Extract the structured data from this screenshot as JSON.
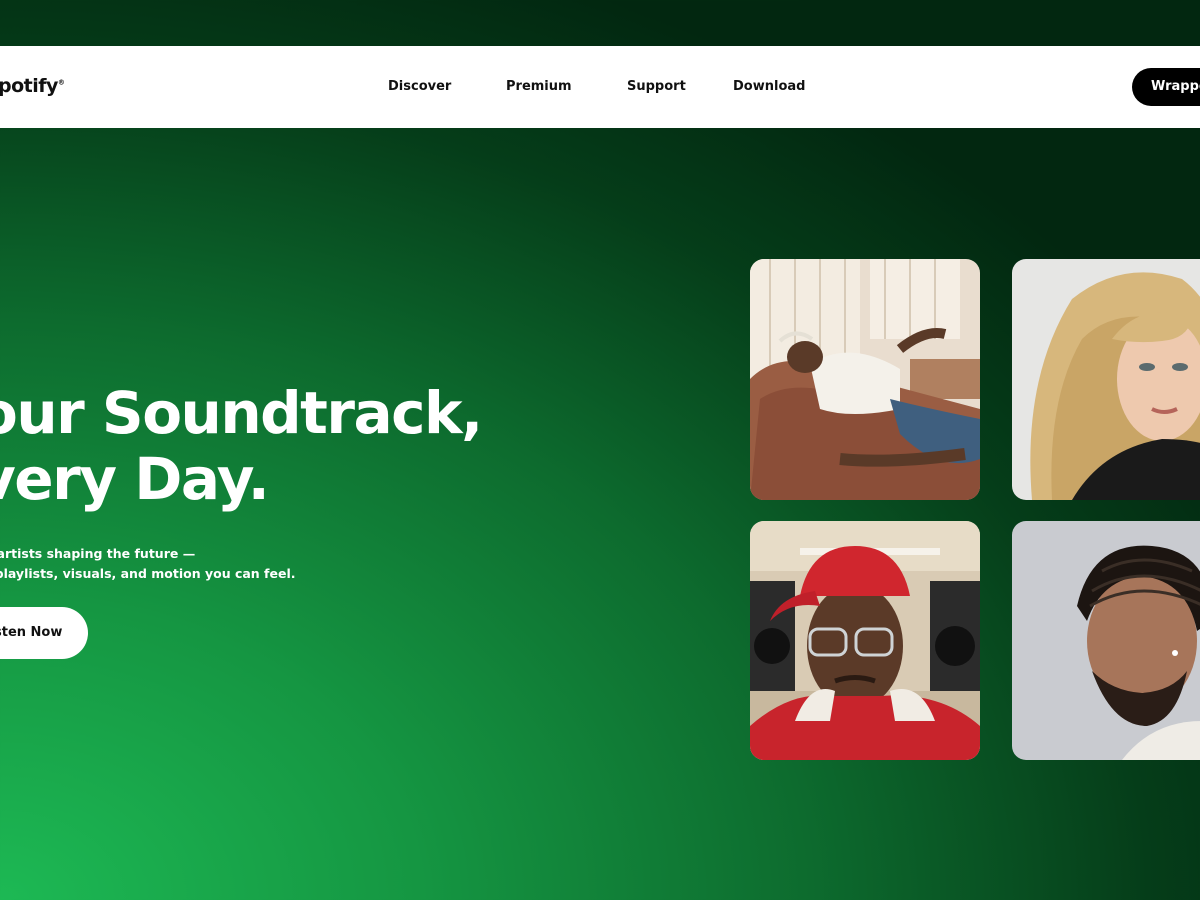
{
  "nav": {
    "logo": "potify",
    "trademark": "®",
    "links": [
      {
        "label": "Discover"
      },
      {
        "label": "Premium"
      },
      {
        "label": "Support"
      },
      {
        "label": "Download"
      }
    ],
    "cta": "Wrapped"
  },
  "hero": {
    "title_line1": "our Soundtrack,",
    "title_line2": "very Day.",
    "subtitle_line1": "r artists shaping the future —",
    "subtitle_line2": "l playlists, visuals, and motion you can feel.",
    "cta": "sten Now"
  },
  "colors": {
    "brand_green": "#1db954",
    "dark_green": "#022710",
    "nav_bg": "#ffffff",
    "button_dark": "#000000"
  },
  "artists": [
    {
      "description": "man lounging on leather couch in white t-shirt"
    },
    {
      "description": "blonde woman portrait"
    },
    {
      "description": "man in red cap and glasses with speakers"
    },
    {
      "description": "man with braids profile"
    }
  ]
}
